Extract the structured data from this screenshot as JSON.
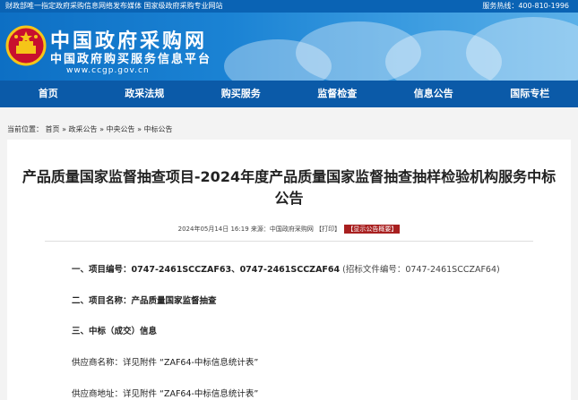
{
  "topbar": {
    "left": "财政部唯一指定政府采购信息网络发布媒体  国家级政府采购专业网站",
    "right": "服务热线：400-810-1996"
  },
  "header": {
    "title": "中国政府采购网",
    "subtitle": "中国政府购买服务信息平台",
    "url": "www.ccgp.gov.cn"
  },
  "nav": [
    "首页",
    "政采法规",
    "购买服务",
    "监督检查",
    "信息公告",
    "国际专栏"
  ],
  "breadcrumb": {
    "prefix": "当前位置：",
    "items": [
      "首页",
      "政采公告",
      "中央公告",
      "中标公告"
    ],
    "sep": " » "
  },
  "article": {
    "title": "产品质量国家监督抽查项目-2024年度产品质量国家监督抽查抽样检验机构服务中标公告",
    "date": "2024年05月14日 16:19",
    "source": "来源：中国政府采购网",
    "print": "【打印】",
    "summary_btn": "【显示公告概要】",
    "l1_label": "一、项目编号：",
    "l1_value": "0747-2461SCCZAF63、0747-2461SCCZAF64",
    "l1_note": "(招标文件编号：0747-2461SCCZAF64)",
    "l2_label": "二、项目名称：",
    "l2_value": "产品质量国家监督抽查",
    "l3": "三、中标（成交）信息",
    "l4": "供应商名称：详见附件 “ZAF64-中标信息统计表”",
    "l5": "供应商地址：详见附件 “ZAF64-中标信息统计表”"
  }
}
